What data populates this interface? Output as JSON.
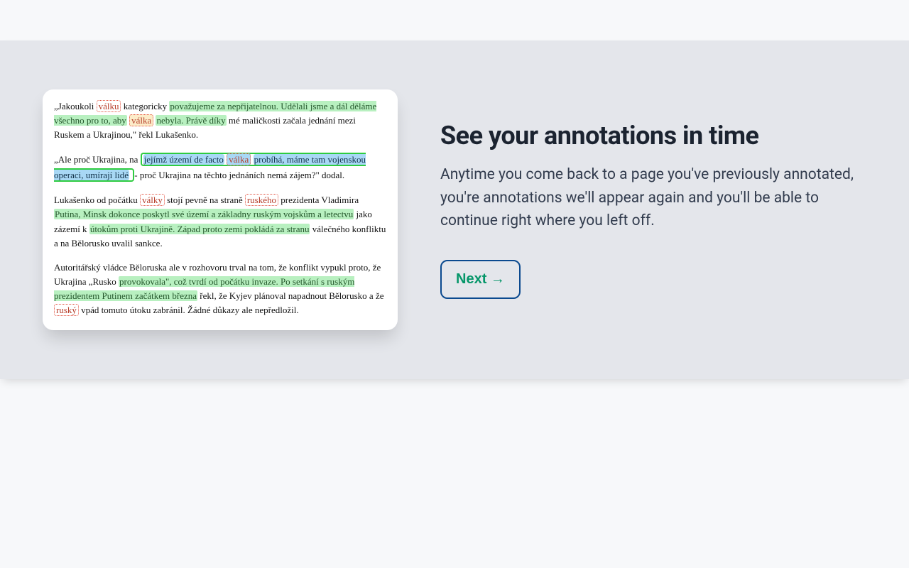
{
  "heading": "See your annotations in time",
  "description": "Anytime you come back to a page you've previously annotated, you're annotations we'll appear again and you'll be able to continue right where you left off.",
  "next_button": "Next →",
  "article": {
    "p1": {
      "t0": "„Jakoukoli ",
      "w1": "válku",
      "t1": " kategoricky ",
      "hl1": "považujeme za nepřijatelnou. Udělali jsme a dál děláme všechno pro to, aby",
      "t2": " ",
      "w2": "válka",
      "t3": " ",
      "hl2": "nebyla. Právě díky",
      "t4": " mé maličkosti začala jednání mezi Ruskem a Ukrajinou,\" řekl Lukašenko."
    },
    "p2": {
      "t0": "„Ale proč Ukrajina, na ",
      "boxstart": "",
      "hl1": "jejímž území de facto",
      "t1": " ",
      "w1": "válka",
      "t2": " ",
      "hl2": "probíhá, máme tam vojenskou operaci, umírají lidé",
      "t3": " - proč Ukrajina na těchto jednáních nemá zájem?\" dodal."
    },
    "p3": {
      "t0": "Lukašenko od počátku ",
      "w1": "války",
      "t1": " stojí pevně na straně ",
      "w2": "ruského",
      "t2": " prezidenta Vladimira ",
      "hl1": "Putina, Minsk dokonce poskytl své území a základny ruským vojskům a letectvu",
      "t3": " jako zázemí k ",
      "hl2": "útokům proti Ukrajině. Západ proto zemi pokládá za stranu",
      "t4": " válečného konfliktu a na Bělorusko uvalil sankce."
    },
    "p4": {
      "t0": "Autoritářský vládce Běloruska ale v rozhovoru trval na tom, že konflikt vypukl proto, že Ukrajina „Rusko ",
      "hl1": "provokovala\", což tvrdí od počátku invaze. Po setkání s ruským prezidentem Putinem začátkem března",
      "t1": " řekl, že Kyjev plánoval napadnout Bělorusko a že ",
      "w1": "ruský",
      "t2": " vpád tomuto útoku zabránil. Žádné důkazy ale nepředložil."
    }
  }
}
